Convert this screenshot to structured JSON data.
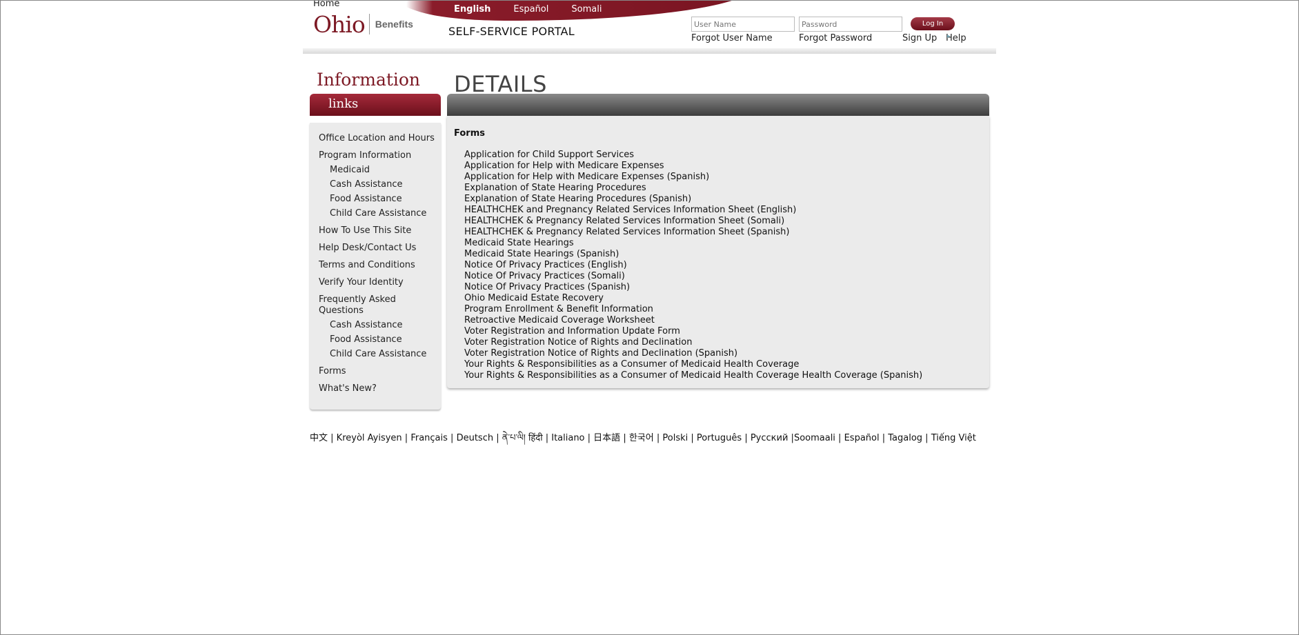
{
  "header": {
    "home_link": "Home",
    "logo_primary": "Ohio",
    "logo_secondary": "Benefits",
    "languages": [
      "English",
      "Español",
      "Somali"
    ],
    "portal_title": "SELF-SERVICE PORTAL",
    "username_placeholder": "User Name",
    "password_placeholder": "Password",
    "login_button": "Log In",
    "forgot_username": "Forgot User Name",
    "forgot_password": "Forgot Password",
    "sign_up": "Sign Up",
    "help": "Help"
  },
  "sidebar": {
    "title": "Information",
    "tab_label": "links",
    "items": [
      {
        "label": "Office Location and Hours",
        "level": 0
      },
      {
        "label": "Program Information",
        "level": 0
      },
      {
        "label": "Medicaid",
        "level": 1
      },
      {
        "label": "Cash Assistance",
        "level": 1
      },
      {
        "label": "Food Assistance",
        "level": 1
      },
      {
        "label": "Child Care Assistance",
        "level": 1
      },
      {
        "label": "How To Use This Site",
        "level": 0
      },
      {
        "label": "Help Desk/Contact Us",
        "level": 0
      },
      {
        "label": "Terms and Conditions",
        "level": 0
      },
      {
        "label": "Verify Your Identity",
        "level": 0
      },
      {
        "label": "Frequently Asked Questions",
        "level": 0
      },
      {
        "label": "Cash Assistance",
        "level": 1
      },
      {
        "label": "Food Assistance",
        "level": 1
      },
      {
        "label": "Child Care Assistance",
        "level": 1
      },
      {
        "label": "Forms",
        "level": 0
      },
      {
        "label": "What's New?",
        "level": 0
      }
    ]
  },
  "details": {
    "title": "DETAILS",
    "section_heading": "Forms",
    "forms": [
      "Application for Child Support Services",
      "Application for Help with Medicare Expenses",
      "Application for Help with Medicare Expenses (Spanish)",
      "Explanation of State Hearing Procedures",
      "Explanation of State Hearing Procedures (Spanish)",
      "HEALTHCHEK and Pregnancy Related Services Information Sheet (English)",
      "HEALTHCHEK & Pregnancy Related Services Information Sheet (Somali)",
      "HEALTHCHEK & Pregnancy Related Services Information Sheet (Spanish)",
      "Medicaid State Hearings",
      "Medicaid State Hearings (Spanish)",
      "Notice Of Privacy Practices (English)",
      "Notice Of Privacy Practices (Somali)",
      "Notice Of Privacy Practices (Spanish)",
      "Ohio Medicaid Estate Recovery",
      "Program Enrollment & Benefit Information",
      "Retroactive Medicaid Coverage Worksheet",
      "Voter Registration and Information Update Form",
      "Voter Registration Notice of Rights and Declination",
      "Voter Registration Notice of Rights and Declination (Spanish)",
      "Your Rights & Responsibilities as a Consumer of Medicaid Health Coverage",
      "Your Rights & Responsibilities as a Consumer of Medicaid Health Coverage Health Coverage (Spanish)"
    ]
  },
  "footer": {
    "languages": [
      "中文",
      "Kreyòl Ayisyen",
      "Français",
      "Deutsch",
      "ནེ་པ་ལི།",
      "हिंदी",
      "Italiano",
      "日本語",
      "한국어",
      "Polski",
      "Português",
      "Русский",
      "Soomaali",
      "Español",
      "Tagalog",
      "Tiếng Việt"
    ]
  },
  "colors": {
    "brand_maroon": "#7d1a25",
    "panel_gray": "#ebebeb",
    "details_bar_dark": "#3d3d3d"
  }
}
